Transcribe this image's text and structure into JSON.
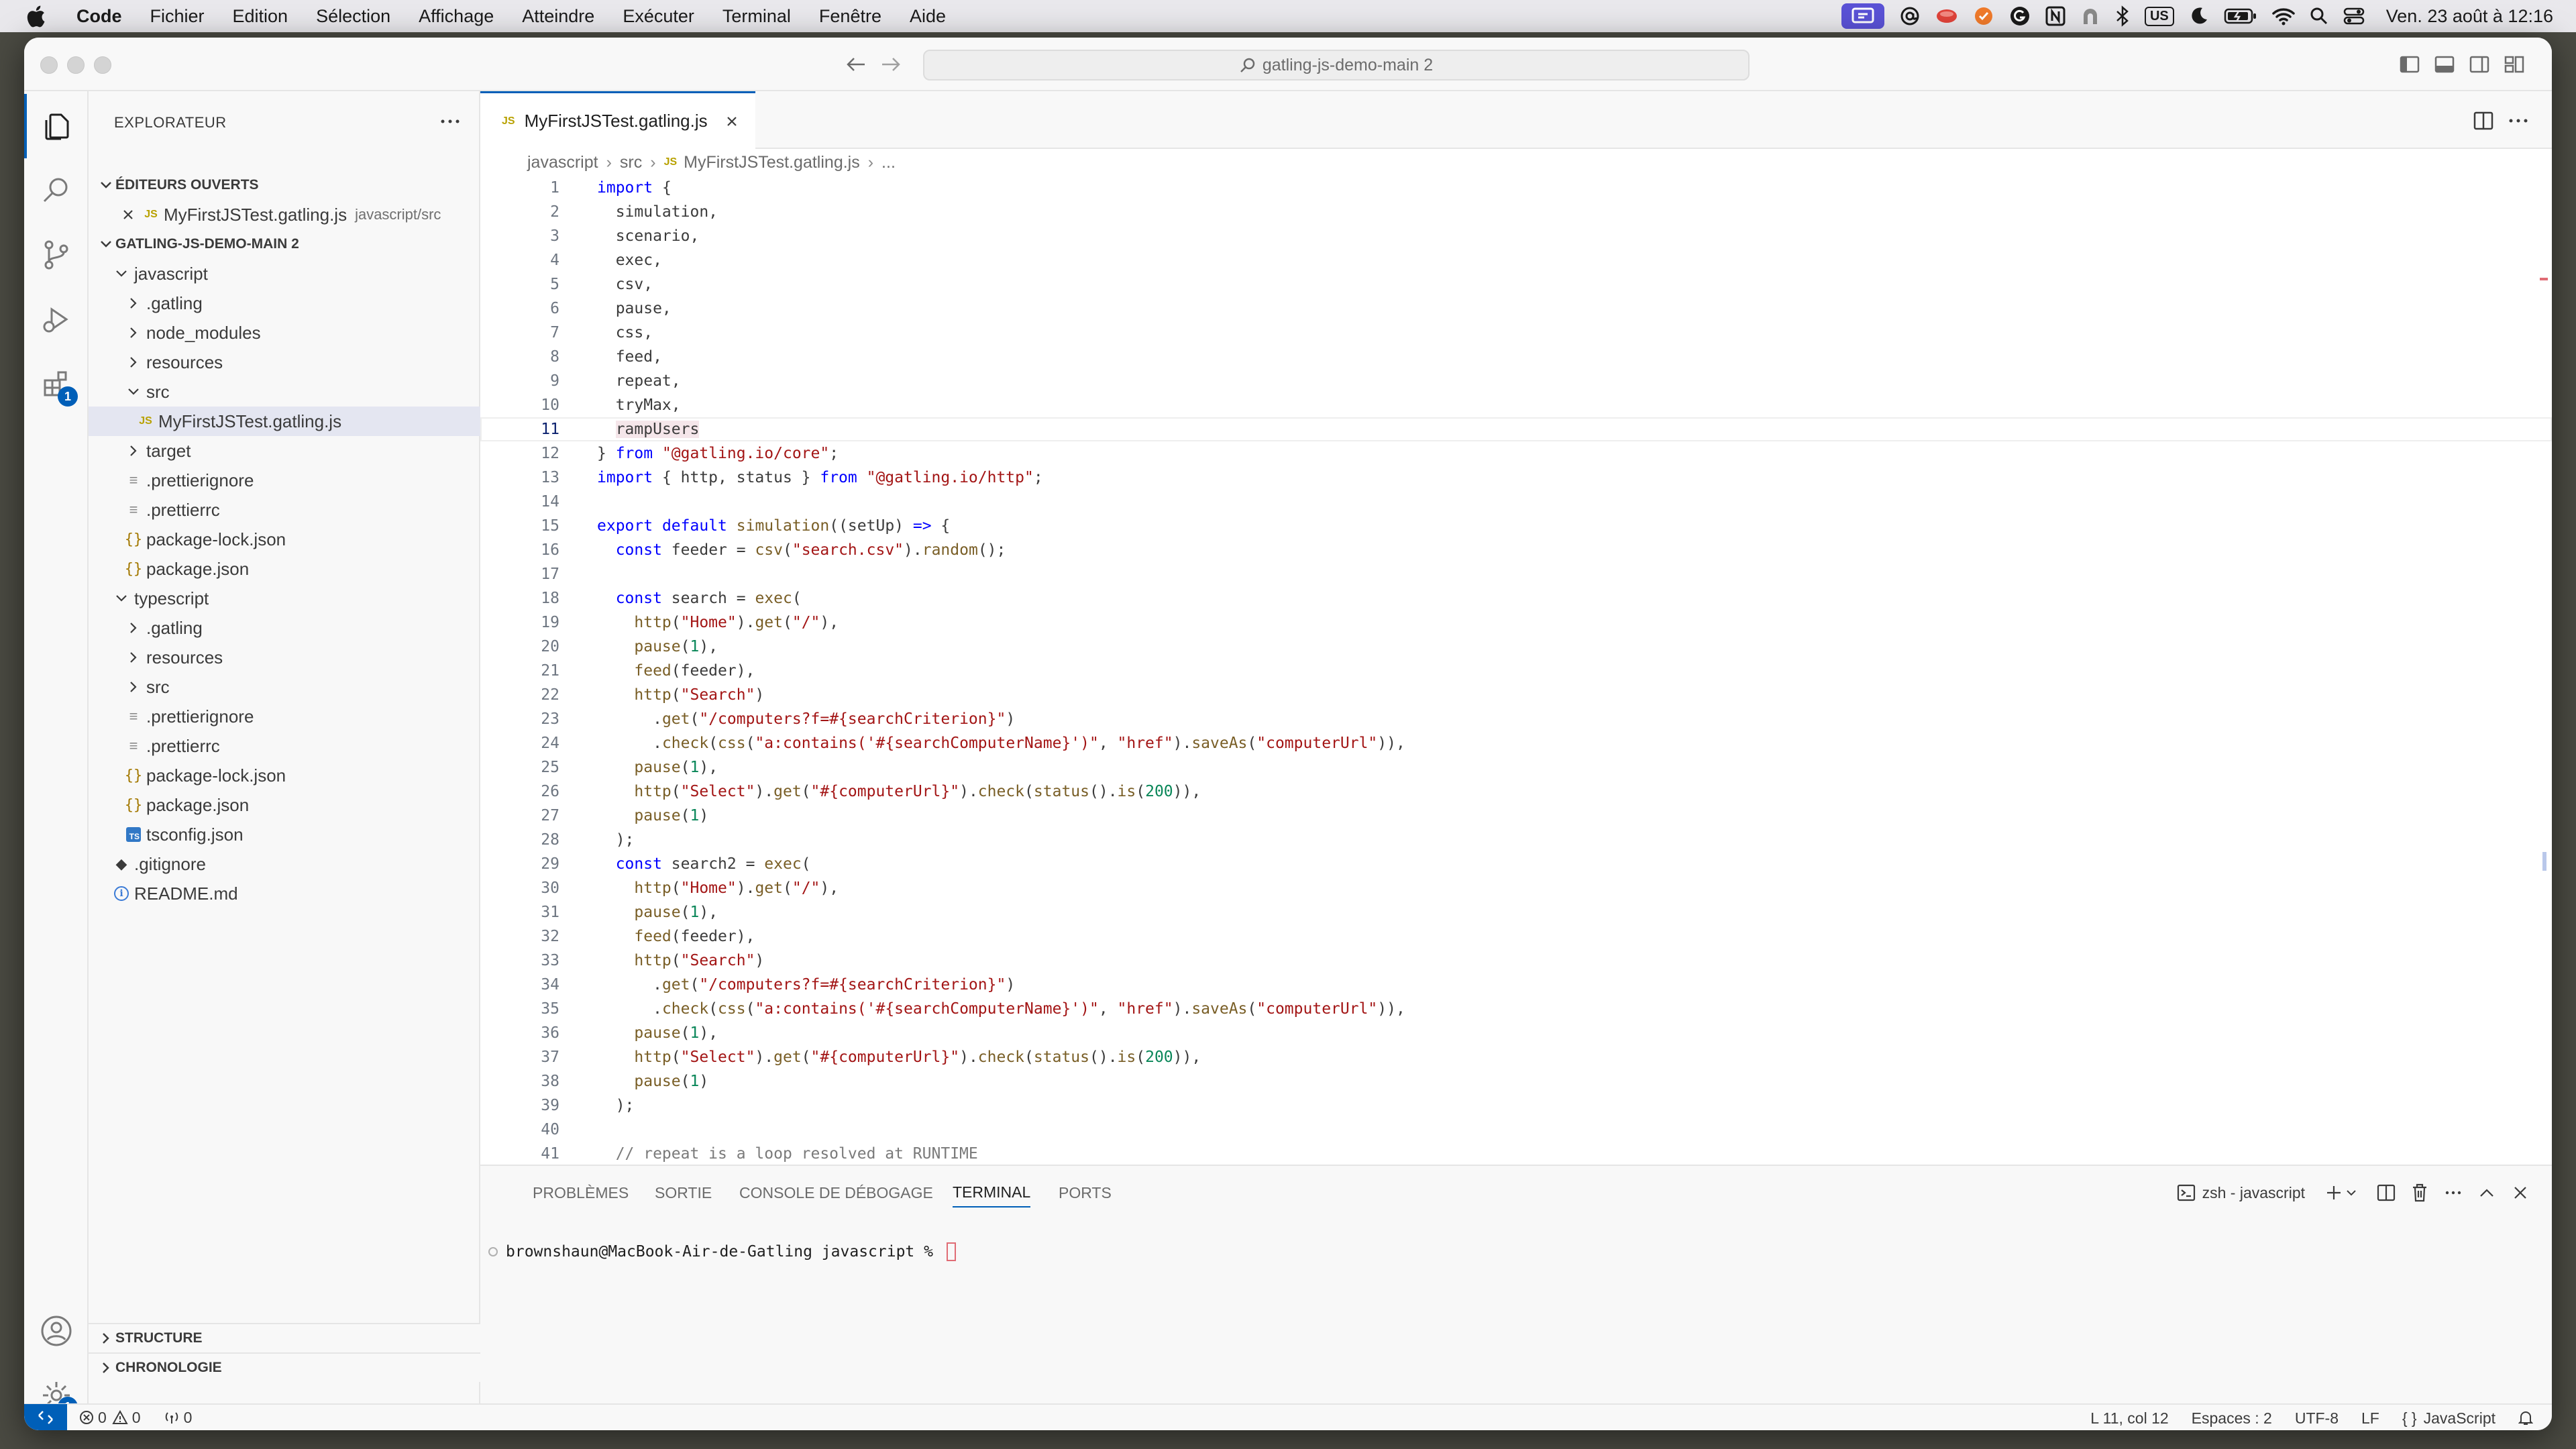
{
  "menubar": {
    "app": "Code",
    "items": [
      "Fichier",
      "Edition",
      "Sélection",
      "Affichage",
      "Atteindre",
      "Exécuter",
      "Terminal",
      "Fenêtre",
      "Aide"
    ],
    "keyboard": "US",
    "clock": "Ven. 23 août à 12:16"
  },
  "window": {
    "command_center": "gatling-js-demo-main 2"
  },
  "sidebar": {
    "title": "EXPLORATEUR",
    "open_editors_header": "ÉDITEURS OUVERTS",
    "open_editor": {
      "name": "MyFirstJSTest.gatling.js",
      "path": "javascript/src"
    },
    "project_header": "GATLING-JS-DEMO-MAIN 2",
    "tree": [
      {
        "label": "javascript",
        "type": "folder-open"
      },
      {
        "label": ".gatling",
        "type": "folder"
      },
      {
        "label": "node_modules",
        "type": "folder"
      },
      {
        "label": "resources",
        "type": "folder"
      },
      {
        "label": "src",
        "type": "folder-open"
      },
      {
        "label": "MyFirstJSTest.gatling.js",
        "type": "js"
      },
      {
        "label": "target",
        "type": "folder"
      },
      {
        "label": ".prettierignore",
        "type": "lines"
      },
      {
        "label": ".prettierrc",
        "type": "lines"
      },
      {
        "label": "package-lock.json",
        "type": "json"
      },
      {
        "label": "package.json",
        "type": "json"
      },
      {
        "label": "typescript",
        "type": "folder-open"
      },
      {
        "label": ".gatling",
        "type": "folder"
      },
      {
        "label": "resources",
        "type": "folder"
      },
      {
        "label": "src",
        "type": "folder"
      },
      {
        "label": ".prettierignore",
        "type": "lines"
      },
      {
        "label": ".prettierrc",
        "type": "lines"
      },
      {
        "label": "package-lock.json",
        "type": "json"
      },
      {
        "label": "package.json",
        "type": "json"
      },
      {
        "label": "tsconfig.json",
        "type": "ts"
      },
      {
        "label": ".gitignore",
        "type": "git"
      },
      {
        "label": "README.md",
        "type": "info"
      }
    ],
    "outline_header": "STRUCTURE",
    "timeline_header": "CHRONOLOGIE",
    "extensions_badge": "1",
    "settings_badge": "1"
  },
  "editor": {
    "tab_label": "MyFirstJSTest.gatling.js",
    "breadcrumbs": [
      "javascript",
      "src",
      "MyFirstJSTest.gatling.js",
      "..."
    ],
    "current_line": 11,
    "lines": [
      "import {",
      "  simulation,",
      "  scenario,",
      "  exec,",
      "  csv,",
      "  pause,",
      "  css,",
      "  feed,",
      "  repeat,",
      "  tryMax,",
      "  rampUsers",
      "} from \"@gatling.io/core\";",
      "import { http, status } from \"@gatling.io/http\";",
      "",
      "export default simulation((setUp) => {",
      "  const feeder = csv(\"search.csv\").random();",
      "",
      "  const search = exec(",
      "    http(\"Home\").get(\"/\"),",
      "    pause(1),",
      "    feed(feeder),",
      "    http(\"Search\")",
      "      .get(\"/computers?f=#{searchCriterion}\")",
      "      .check(css(\"a:contains('#{searchComputerName}')\", \"href\").saveAs(\"computerUrl\")),",
      "    pause(1),",
      "    http(\"Select\").get(\"#{computerUrl}\").check(status().is(200)),",
      "    pause(1)",
      "  );",
      "  const search2 = exec(",
      "    http(\"Home\").get(\"/\"),",
      "    pause(1),",
      "    feed(feeder),",
      "    http(\"Search\")",
      "      .get(\"/computers?f=#{searchCriterion}\")",
      "      .check(css(\"a:contains('#{searchComputerName}')\", \"href\").saveAs(\"computerUrl\")),",
      "    pause(1),",
      "    http(\"Select\").get(\"#{computerUrl}\").check(status().is(200)),",
      "    pause(1)",
      "  );",
      "",
      "  // repeat is a loop resolved at RUNTIME"
    ]
  },
  "panel": {
    "tabs": [
      "PROBLÈMES",
      "SORTIE",
      "CONSOLE DE DÉBOGAGE",
      "TERMINAL",
      "PORTS"
    ],
    "active_tab": "TERMINAL",
    "terminal_name": "zsh - javascript",
    "prompt": "brownshaun@MacBook-Air-de-Gatling javascript % "
  },
  "statusbar": {
    "errors": "0",
    "warnings": "0",
    "ports": "0",
    "position": "L 11, col 12",
    "indent": "Espaces : 2",
    "encoding": "UTF-8",
    "eol": "LF",
    "language": "JavaScript"
  },
  "colors": {
    "accent": "#005fb8",
    "menubar_bg": "#e9e8ec",
    "editor_bg": "#ffffff",
    "chrome_bg": "#f8f8f8"
  }
}
